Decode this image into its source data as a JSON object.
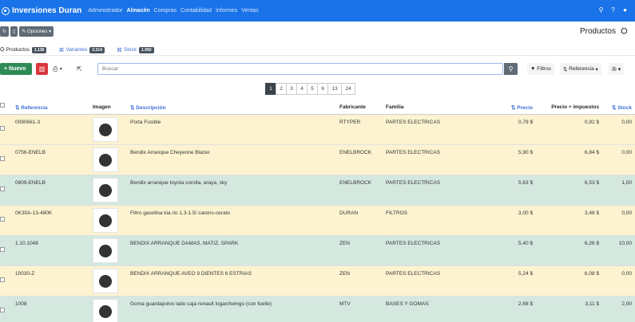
{
  "navbar": {
    "brand": "Inversiones Duran",
    "links": [
      "Administrador",
      "Almacén",
      "Compras",
      "Contabilidad",
      "Informes",
      "Ventas"
    ],
    "active": "Almacén"
  },
  "toolbar": {
    "options_label": "Opciones",
    "page_title": "Productos"
  },
  "tabs": [
    {
      "label": "Productos",
      "count": "1.136"
    },
    {
      "label": "Variantes",
      "count": "2.314"
    },
    {
      "label": "Stock",
      "count": "1.692"
    }
  ],
  "actions": {
    "new_label": "Nuevo",
    "search_placeholder": "Buscar",
    "filters_label": "Filtros",
    "order_label": "Referencia"
  },
  "pagination": [
    "1",
    "2",
    "3",
    "4",
    "5",
    "6",
    "13",
    "24"
  ],
  "columns": {
    "ref": "Referencia",
    "img": "Imagen",
    "desc": "Descripción",
    "fab": "Fabricante",
    "fam": "Familia",
    "precio": "Precio",
    "precio_imp": "Precio + impuestos",
    "stock": "Stock"
  },
  "rows": [
    {
      "ref": "0090661-3",
      "desc": "Porta Fusible",
      "fab": "RTYPER",
      "fam": "PARTES ELECTRICAS",
      "precio": "0,79 $",
      "precio_imp": "0,92 $",
      "stock": "0,00",
      "color": "#fdf3d0"
    },
    {
      "ref": "0756-ENELB",
      "desc": "Bendix Arranque Cheyenne Blazer",
      "fab": "ENELBROCK",
      "fam": "PARTES ELECTRICAS",
      "precio": "5,90 $",
      "precio_imp": "6,84 $",
      "stock": "0,00",
      "color": "#fdf3d0"
    },
    {
      "ref": "0809-ENELB",
      "desc": "Bendix arranque toyota corolla, araya, sky",
      "fab": "ENELBROCK",
      "fam": "PARTES ELECTRICAS",
      "precio": "5,63 $",
      "precio_imp": "6,53 $",
      "stock": "1,00",
      "color": "#d4e8df"
    },
    {
      "ref": "0K30A-13-480K",
      "desc": "Filtro gasolina kia rio 1.3-1.5/ carens-cerato",
      "fab": "DURAN",
      "fam": "FILTROS",
      "precio": "3,00 $",
      "precio_imp": "3,48 $",
      "stock": "0,00",
      "color": "#fdf3d0"
    },
    {
      "ref": "1.10.1048",
      "desc": "BENDIX ARRANQUE DAMAS, MATIZ, SPARK",
      "fab": "ZEN",
      "fam": "PARTES ELECTRICAS",
      "precio": "5,40 $",
      "precio_imp": "6,26 $",
      "stock": "10,00",
      "color": "#d4e8df"
    },
    {
      "ref": "10030-Z",
      "desc": "BENDIX ARRANQUE AVEO 9 DIENTES 6 ESTRIAS",
      "fab": "ZEN",
      "fam": "PARTES ELECTRICAS",
      "precio": "5,24 $",
      "precio_imp": "6,08 $",
      "stock": "0,00",
      "color": "#fdf3d0"
    },
    {
      "ref": "1008",
      "desc": "Goma guardapolvo lado caja renault logan/twingo (con fuelle)",
      "fab": "MTV",
      "fam": "BASES Y GOMAS",
      "precio": "2,68 $",
      "precio_imp": "3,11 $",
      "stock": "2,00",
      "color": "#d4e8df"
    }
  ]
}
